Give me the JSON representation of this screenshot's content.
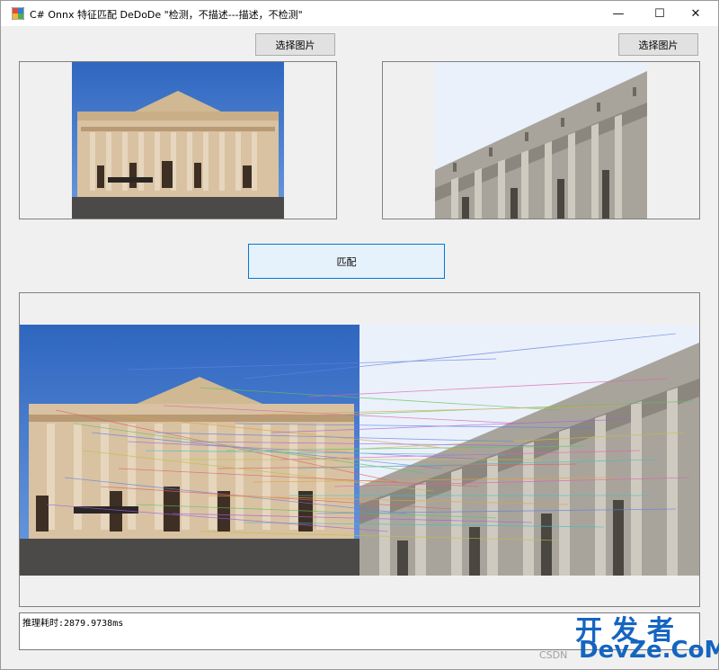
{
  "window": {
    "title": "C# Onnx 特征匹配 DeDoDe \"检测，不描述---描述，不检测\"",
    "minimize_glyph": "—",
    "maximize_glyph": "☐",
    "close_glyph": "✕"
  },
  "buttons": {
    "select_image_left": "选择图片",
    "select_image_right": "选择图片",
    "match": "匹配"
  },
  "log": {
    "text": "推理耗时:2879.9738ms"
  },
  "watermark": {
    "cn": "开发者",
    "en": "DevZe.CoM",
    "csdn": "CSDN"
  },
  "colors": {
    "sky": "#3a74c8",
    "stone": "#d9c6aa",
    "accent": "#0078d7"
  }
}
